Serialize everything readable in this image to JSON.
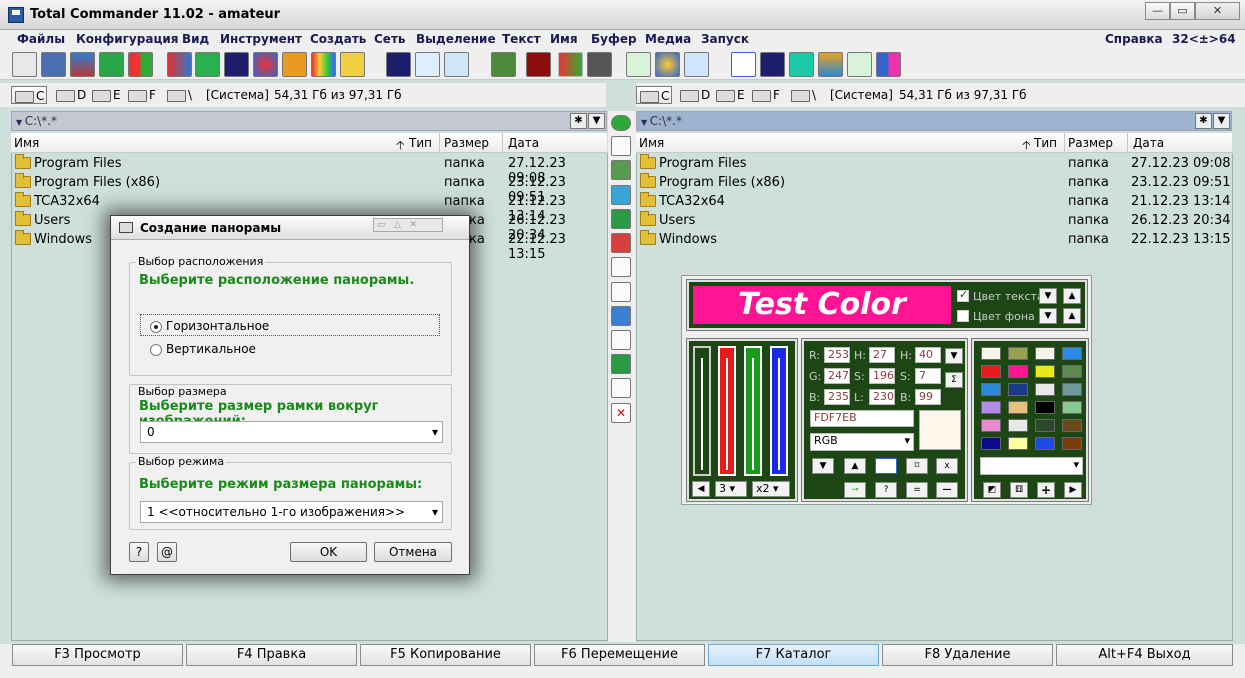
{
  "window": {
    "title": "Total Commander 11.02 - amateur",
    "controls": [
      "—",
      "▭",
      "✕"
    ]
  },
  "menu": [
    "Файлы",
    "Конфигурация",
    "Вид",
    "Инструмент",
    "Создать",
    "Сеть",
    "Выделение",
    "Текст",
    "Имя",
    "Буфер",
    "Медиа",
    "Запуск"
  ],
  "menu_right": {
    "help": "Справка",
    "bits": "32<±>64"
  },
  "toolbar_icons": [
    "printer-icon",
    "cube-icon",
    "monitor-icon",
    "shield-icon",
    "windows-icon",
    "compare-icon",
    "sync-icon",
    "film-icon",
    "chart-icon",
    "gear-icon",
    "palette-icon",
    "pdf-icon",
    "filmstrip-icon",
    "list-icon",
    "text-icon",
    "screen-icon",
    "flash-icon",
    "umbrella-icon",
    "phone-icon",
    "clipboard-icon",
    "globe-icon",
    "split-icon",
    "mp3-icon",
    "convert-icon",
    "music-icon",
    "image-icon",
    "cut-icon",
    "audio-icon"
  ],
  "drives": {
    "letters": [
      "C",
      "D",
      "E",
      "F",
      "\\"
    ],
    "info_label": "[Система]",
    "info_space": "54,31 Гб из 97,31 Гб"
  },
  "left_panel": {
    "path": "C:\\*.*"
  },
  "right_panel": {
    "path": "C:\\*.*"
  },
  "columns": {
    "name": "Имя",
    "type": "Тип",
    "size": "Размер",
    "date": "Дата"
  },
  "files": [
    {
      "name": "Program Files",
      "size": "папка",
      "date": "27.12.23 09:08"
    },
    {
      "name": "Program Files (x86)",
      "size": "папка",
      "date": "23.12.23 09:51"
    },
    {
      "name": "TCA32x64",
      "size": "папка",
      "date": "21.12.23 13:14"
    },
    {
      "name": "Users",
      "size": "папка",
      "date": "26.12.23 20:34"
    },
    {
      "name": "Windows",
      "size": "папка",
      "date": "22.12.23 13:15"
    }
  ],
  "fkeys": [
    "F3 Просмотр",
    "F4 Правка",
    "F5 Копирование",
    "F6 Перемещение",
    "F7 Каталог",
    "F8 Удаление",
    "Alt+F4 Выход"
  ],
  "dialog": {
    "title": "Создание панорамы",
    "group1": {
      "label": "Выбор расположения",
      "text": "Выберите расположение панорамы.",
      "opt1": "Горизонтальное",
      "opt2": "Вертикальное"
    },
    "group2": {
      "label": "Выбор размера",
      "text": "Выберите размер рамки вокруг изображений:",
      "value": "0"
    },
    "group3": {
      "label": "Выбор режима",
      "text": "Выберите режим размера панорамы:",
      "value": "1 <<относительно 1-го изображения>>"
    },
    "help": "?",
    "at": "@",
    "ok": "OK",
    "cancel": "Отмена"
  },
  "color_widget": {
    "banner": "Test Color",
    "text_color_label": "Цвет текста",
    "bg_color_label": "Цвет фона",
    "r": "253",
    "g": "247",
    "b": "235",
    "h": "27",
    "s": "196",
    "l": "230",
    "hsv_h": "40",
    "hsv_s": "7",
    "hsv_b": "99",
    "labels": {
      "r": "R:",
      "g": "G:",
      "b": "B:",
      "h": "H:",
      "s": "S:",
      "l": "L:",
      "hh": "H:",
      "ss": "S:",
      "bb": "B:"
    },
    "hex": "FDF7EB",
    "mode": "RGB",
    "step": "3",
    "zoom": "x2",
    "banner_color": "#ff1493",
    "swatch_color": "#FDF7EB"
  }
}
